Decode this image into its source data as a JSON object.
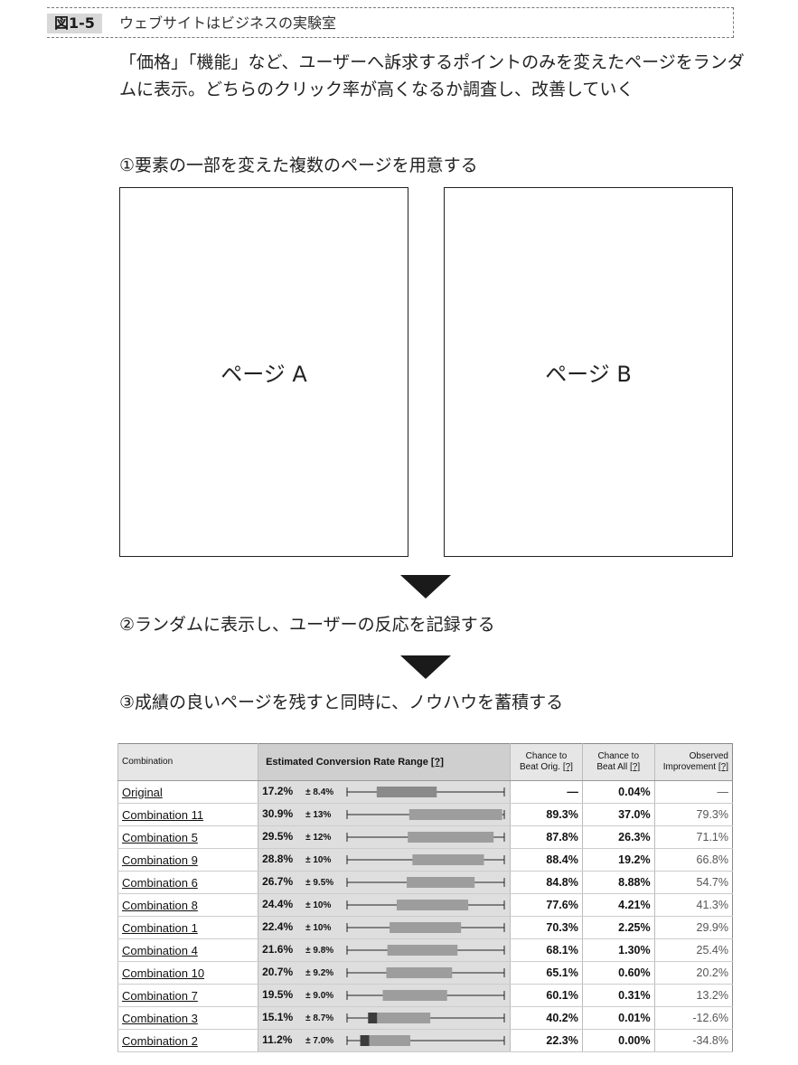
{
  "figure": {
    "number": "図1-5",
    "title": "ウェブサイトはビジネスの実験室",
    "intro": "「価格」「機能」など、ユーザーへ訴求するポイントのみを変えたページをランダムに表示。どちらのクリック率が高くなるか調査し、改善していく"
  },
  "steps": [
    "①要素の一部を変えた複数のページを用意する",
    "②ランダムに表示し、ユーザーの反応を記録する",
    "③成績の良いページを残すと同時に、ノウハウを蓄積する"
  ],
  "pages": {
    "a": "ページ A",
    "b": "ページ B"
  },
  "table": {
    "headers": {
      "combination": "Combination",
      "estimated": "Estimated Conversion Rate Range",
      "help": "[?]",
      "beat_orig_1": "Chance to",
      "beat_orig_2": "Beat Orig.",
      "beat_all_1": "Chance to",
      "beat_all_2": "Beat All",
      "observed_1": "Observed",
      "observed_2": "Improvement"
    },
    "rows": [
      {
        "name": "Original",
        "rate": "17.2%",
        "err": "± 8.4%",
        "beat_orig": "—",
        "beat_all": "0.04%",
        "observed": "—",
        "mean": 17.2,
        "margin": 8.4
      },
      {
        "name": "Combination 11",
        "rate": "30.9%",
        "err": "± 13%",
        "beat_orig": "89.3%",
        "beat_all": "37.0%",
        "observed": "79.3%",
        "mean": 30.9,
        "margin": 13
      },
      {
        "name": "Combination 5",
        "rate": "29.5%",
        "err": "± 12%",
        "beat_orig": "87.8%",
        "beat_all": "26.3%",
        "observed": "71.1%",
        "mean": 29.5,
        "margin": 12
      },
      {
        "name": "Combination 9",
        "rate": "28.8%",
        "err": "± 10%",
        "beat_orig": "88.4%",
        "beat_all": "19.2%",
        "observed": "66.8%",
        "mean": 28.8,
        "margin": 10
      },
      {
        "name": "Combination 6",
        "rate": "26.7%",
        "err": "± 9.5%",
        "beat_orig": "84.8%",
        "beat_all": "8.88%",
        "observed": "54.7%",
        "mean": 26.7,
        "margin": 9.5
      },
      {
        "name": "Combination 8",
        "rate": "24.4%",
        "err": "± 10%",
        "beat_orig": "77.6%",
        "beat_all": "4.21%",
        "observed": "41.3%",
        "mean": 24.4,
        "margin": 10
      },
      {
        "name": "Combination 1",
        "rate": "22.4%",
        "err": "± 10%",
        "beat_orig": "70.3%",
        "beat_all": "2.25%",
        "observed": "29.9%",
        "mean": 22.4,
        "margin": 10
      },
      {
        "name": "Combination 4",
        "rate": "21.6%",
        "err": "± 9.8%",
        "beat_orig": "68.1%",
        "beat_all": "1.30%",
        "observed": "25.4%",
        "mean": 21.6,
        "margin": 9.8
      },
      {
        "name": "Combination 10",
        "rate": "20.7%",
        "err": "± 9.2%",
        "beat_orig": "65.1%",
        "beat_all": "0.60%",
        "observed": "20.2%",
        "mean": 20.7,
        "margin": 9.2
      },
      {
        "name": "Combination 7",
        "rate": "19.5%",
        "err": "± 9.0%",
        "beat_orig": "60.1%",
        "beat_all": "0.31%",
        "observed": "13.2%",
        "mean": 19.5,
        "margin": 9.0
      },
      {
        "name": "Combination 3",
        "rate": "15.1%",
        "err": "± 8.7%",
        "beat_orig": "40.2%",
        "beat_all": "0.01%",
        "observed": "-12.6%",
        "mean": 15.1,
        "margin": 8.7
      },
      {
        "name": "Combination 2",
        "rate": "11.2%",
        "err": "± 7.0%",
        "beat_orig": "22.3%",
        "beat_all": "0.00%",
        "observed": "-34.8%",
        "mean": 11.2,
        "margin": 7.0
      }
    ],
    "colors": {
      "original_bar": "#8a8a8a",
      "better_bar": "#9d9d9d",
      "worse_bar": "#3c3c3c"
    }
  }
}
